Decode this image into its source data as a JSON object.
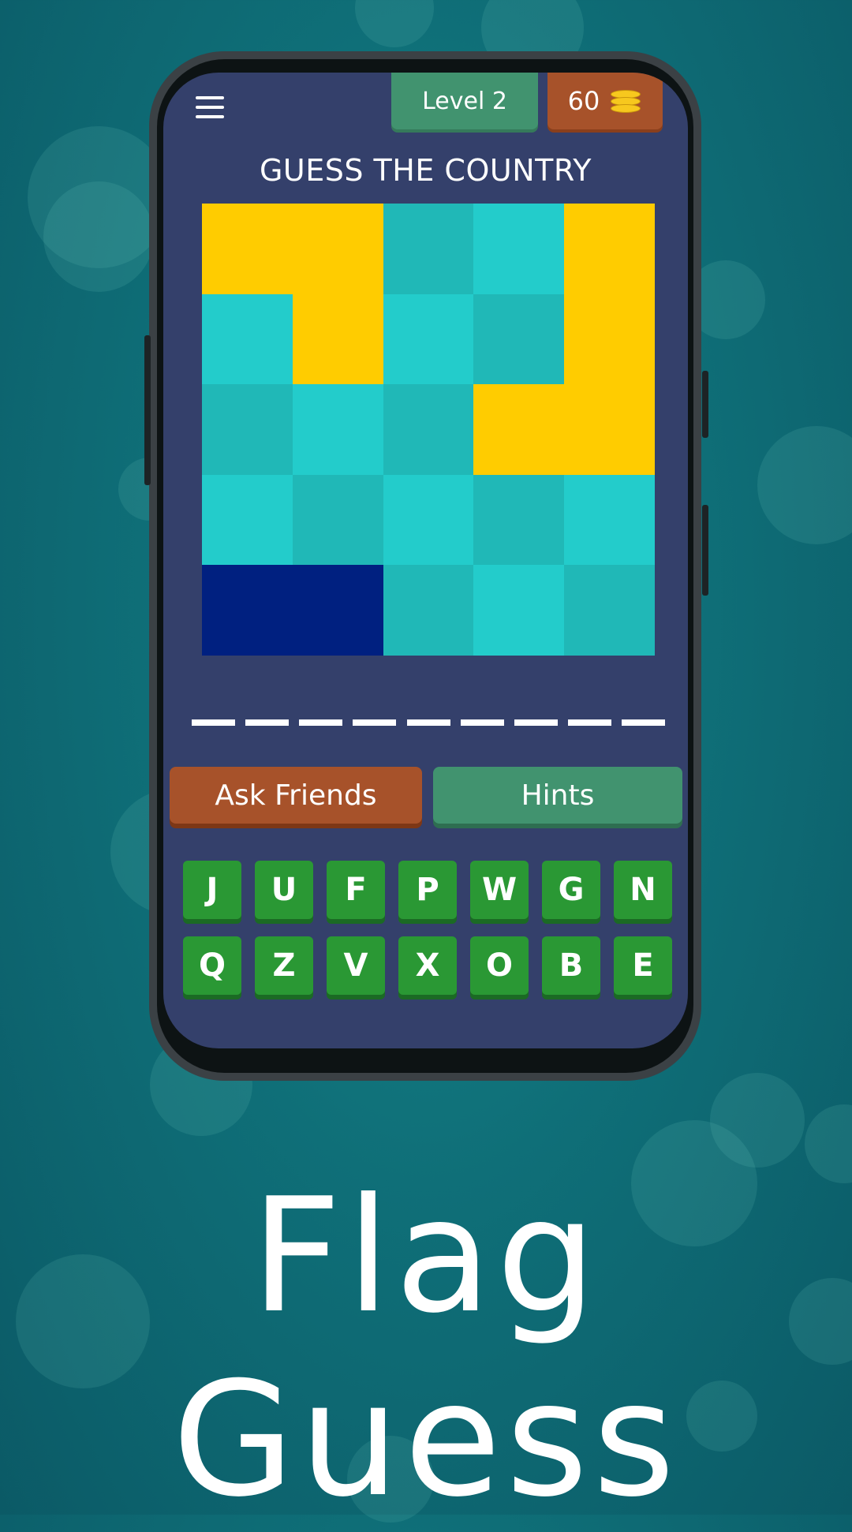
{
  "header": {
    "level_label": "Level 2",
    "coins": "60"
  },
  "game": {
    "prompt": "GUESS THE COUNTRY",
    "answer_length": 9,
    "flag_tiles": [
      [
        "#ffcc00",
        "#ffcc00",
        "#20b8b7",
        "#23cccb",
        "#ffcc00"
      ],
      [
        "#23cccb",
        "#ffcc00",
        "#23cccb",
        "#20b8b7",
        "#ffcc00"
      ],
      [
        "#20b8b7",
        "#23cccb",
        "#20b8b7",
        "#ffcc00",
        "#ffcc00"
      ],
      [
        "#23cccb",
        "#20b8b7",
        "#23cccb",
        "#20b8b7",
        "#23cccb"
      ],
      [
        "#002080",
        "#002080",
        "#20b8b7",
        "#23cccb",
        "#20b8b7"
      ]
    ]
  },
  "buttons": {
    "ask_friends": "Ask Friends",
    "hints": "Hints"
  },
  "keyboard": {
    "rows": [
      [
        "J",
        "U",
        "F",
        "P",
        "W",
        "G",
        "N"
      ],
      [
        "Q",
        "Z",
        "V",
        "X",
        "O",
        "B",
        "E"
      ]
    ]
  },
  "branding": {
    "app_name": "Flag Guess"
  },
  "colors": {
    "screen_bg": "#34406b",
    "level_green": "#41936f",
    "coin_orange": "#a7522a",
    "key_green": "#2a9834"
  }
}
